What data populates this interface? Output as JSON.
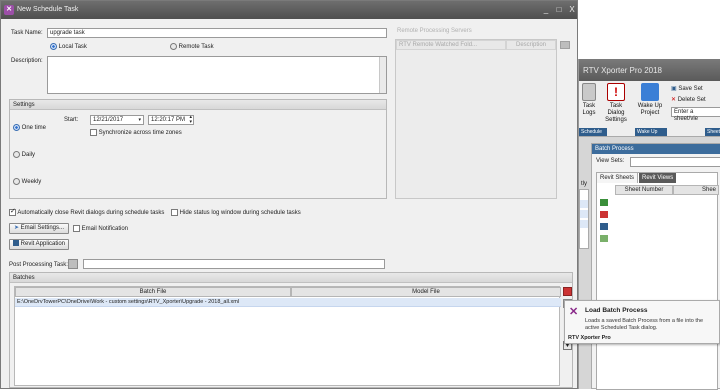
{
  "window": {
    "title": "New Schedule Task",
    "min": "_",
    "max": "□",
    "close": "X"
  },
  "task_name": {
    "label": "Task Name:",
    "value": "upgrade task"
  },
  "task_type": {
    "local": "Local Task",
    "remote": "Remote Task",
    "selected": "local"
  },
  "description": {
    "label": "Description:",
    "value": ""
  },
  "remote": {
    "title": "Remote Processing Servers",
    "col1": "RTV Remote Watched Fold...",
    "col2": "Description"
  },
  "settings": {
    "title": "Settings",
    "start_label": "Start:",
    "date": "12/21/2017",
    "time": "12:20:17 PM",
    "sync_label": "Synchronize across time zones",
    "one_time": "One time",
    "daily": "Daily",
    "weekly": "Weekly"
  },
  "options": {
    "auto_close": "Automatically close Revit dialogs during schedule tasks",
    "hide_status": "Hide status log window during schedule tasks",
    "email_settings": "Email Settings...",
    "email_notification": "Email Notification",
    "revit_application": "Revit Application"
  },
  "post_processing": {
    "label": "Post Processing Task:",
    "value": ""
  },
  "batches": {
    "title": "Batches",
    "columns": [
      "Batch File",
      "Model File"
    ],
    "rows": [
      {
        "batch_file": "E:\\OneDrvTowerPC\\OneDrive\\Work - custom settings\\RTV_Xporter\\Upgrade - 2018_all.xml",
        "model_file": ""
      }
    ]
  },
  "tooltip": {
    "title": "Load Batch Process",
    "body": "Loads a saved Batch Process from a file into the active Scheduled Task dialog.",
    "footer": "RTV Xporter Pro"
  },
  "background_app": {
    "title": "RTV Xporter Pro 2018",
    "ribbon": {
      "task_logs": "Task Logs",
      "task_dialog": "Task Dialog Settings",
      "wake_up": "Wake Up Project",
      "save_set": "Save Set",
      "delete_set": "Delete Set",
      "sheet_input_placeholder": "Enter a sheet/vie",
      "group_schedule": "Schedule",
      "group_wakeup": "Wake Up",
      "group_sheets": "Sheet"
    },
    "panel_title": "Batch Process",
    "view_sets_label": "View Sets:",
    "tab_sheets": "Revit Sheets",
    "tab_views": "Revit Views",
    "col_sheet_number": "Sheet Number",
    "col_sheet": "Shee",
    "left_col_label": "tly"
  },
  "colors": {
    "titlebar": "#5a5a5a",
    "accent_blue": "#2f6fd0",
    "selected_row": "#dde8f7"
  }
}
